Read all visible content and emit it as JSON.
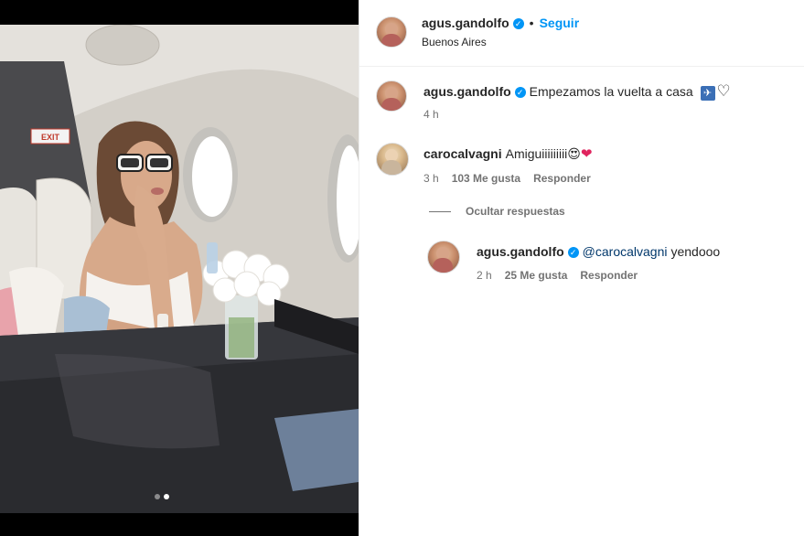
{
  "post": {
    "author": "agus.gandolfo",
    "follow_label": "Seguir",
    "separator": "•",
    "location": "Buenos Aires",
    "carousel": {
      "count": 2,
      "active_index": 1
    }
  },
  "caption": {
    "username": "agus.gandolfo",
    "text": "Empezamos la vuelta a casa",
    "emoji_airplane": "✈",
    "emoji_heart": "♡",
    "time": "4 h"
  },
  "comments": [
    {
      "username": "carocalvagni",
      "text": "Amiguiiiiiiiii",
      "emoji_1": "😍",
      "emoji_2": "❤",
      "time": "3 h",
      "likes": "103 Me gusta",
      "reply_label": "Responder"
    }
  ],
  "replies_toggle": {
    "label": "Ocultar respuestas"
  },
  "reply": {
    "username": "agus.gandolfo",
    "mention": "@carocalvagni",
    "text": "yendooo",
    "time": "2 h",
    "likes": "25 Me gusta",
    "reply_label": "Responder"
  },
  "colors": {
    "accent": "#0095f6",
    "text": "#262626",
    "muted": "#737373",
    "mention": "#00376b"
  },
  "icons": {
    "verified": "verified-badge-icon",
    "exit_sign": "exit-sign"
  },
  "photo_labels": {
    "exit": "EXIT"
  }
}
